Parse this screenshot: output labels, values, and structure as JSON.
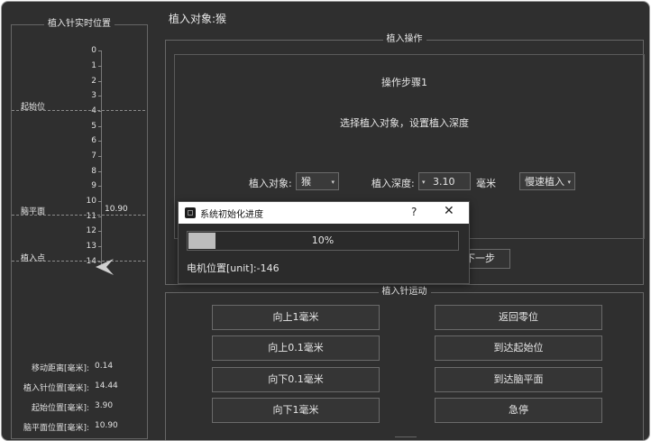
{
  "ruler": {
    "title": "植入针实时位置",
    "ticks": [
      "0",
      "1",
      "2",
      "3",
      "4",
      "5",
      "6",
      "7",
      "8",
      "9",
      "10",
      "11",
      "12",
      "13",
      "14"
    ],
    "markers": {
      "start": "起始位",
      "face": "脑平面",
      "face_value": "10.90",
      "insert": "植入点"
    }
  },
  "stats": [
    {
      "label": "移动距离[毫米]:",
      "value": "0.14"
    },
    {
      "label": "植入针位置[毫米]:",
      "value": "14.44"
    },
    {
      "label": "起始位置[毫米]:",
      "value": "3.90"
    },
    {
      "label": "脑平面位置[毫米]:",
      "value": "10.90"
    }
  ],
  "header": {
    "target": "植入对象:猴"
  },
  "operation": {
    "title": "植入操作",
    "step": "操作步骤1",
    "instruction": "选择植入对象，设置植入深度",
    "object_label": "植入对象:",
    "object_value": "猴",
    "depth_label": "植入深度:",
    "depth_value": "3.10",
    "depth_unit": "毫米",
    "speed_value": "慢速植入",
    "next": "下一步"
  },
  "motion": {
    "title": "植入针运动",
    "buttons": [
      "向上1毫米",
      "返回零位",
      "向上0.1毫米",
      "到达起始位",
      "向下0.1毫米",
      "到达脑平面",
      "向下1毫米",
      "急停"
    ]
  },
  "dialog": {
    "title": "系统初始化进度",
    "help": "?",
    "close": "✕",
    "progress": 0.1,
    "progress_text": "10%",
    "status": "电机位置[unit]:-146"
  }
}
